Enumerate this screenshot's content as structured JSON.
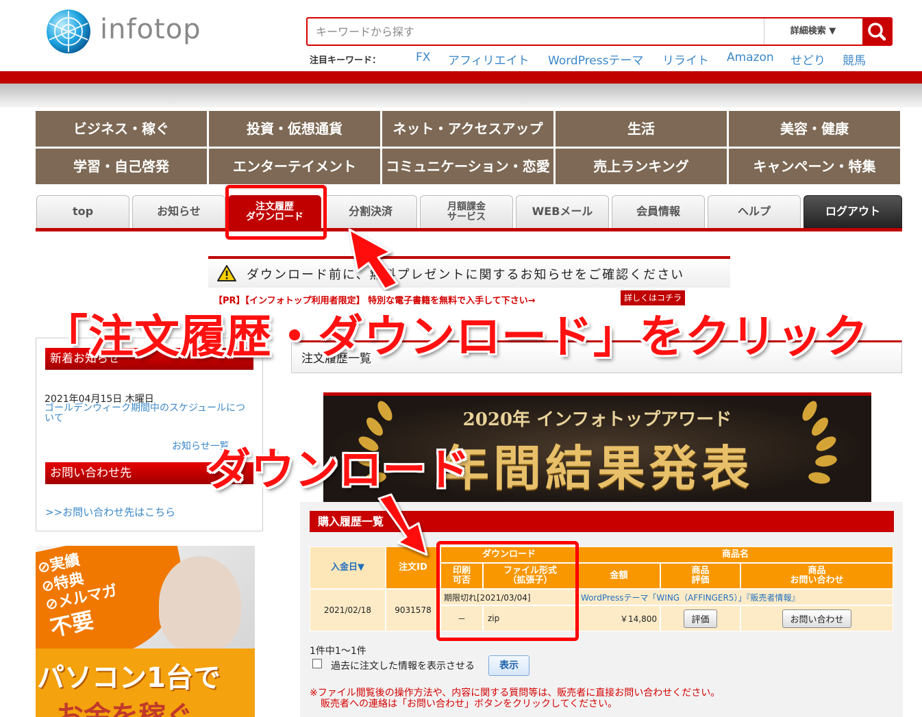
{
  "header": {
    "logo_text": "infotop",
    "search_placeholder": "キーワードから探す",
    "detail_search": "詳細検索 ▼",
    "keywords_label": "注目キーワード：",
    "keywords": [
      "FX",
      "アフィリエイト",
      "WordPressテーマ",
      "リライト",
      "Amazon",
      "せどり",
      "競馬"
    ]
  },
  "categories": [
    "ビジネス・稼ぐ",
    "投資・仮想通貨",
    "ネット・アクセスアップ",
    "生活",
    "美容・健康",
    "学習・自己啓発",
    "エンターテイメント",
    "コミュニケーション・恋愛",
    "売上ランキング",
    "キャンペーン・特集"
  ],
  "tabs": [
    {
      "label": "top"
    },
    {
      "label": "お知らせ"
    },
    {
      "label": "注文履歴\nダウンロード"
    },
    {
      "label": "分割決済"
    },
    {
      "label": "月額課金\nサービス"
    },
    {
      "label": "WEBメール"
    },
    {
      "label": "会員情報"
    },
    {
      "label": "ヘルプ"
    },
    {
      "label": "ログアウト"
    }
  ],
  "notice": {
    "text": "ダウンロード前に、無料プレゼントに関するお知らせをご確認ください",
    "pr_text": "【PR】【インフォトップ利用者限定】 特別な電子書籍を無料で入手して下さい→",
    "pr_button": "詳しくはコチラ"
  },
  "annotations": {
    "main": "「注文履歴・ダウンロード」をクリック",
    "download": "ダウンロード"
  },
  "sidebar": {
    "news_heading": "新着お知らせ",
    "news_date": "2021年04月15日 木曜日",
    "news_link": "ゴールデンウィーク期間中のスケジュールについて",
    "news_more": "お知らせ一覧",
    "contact_heading": "お問い合わせ先",
    "contact_link": ">>お問い合わせ先はこちら",
    "promo_badges": [
      "実績",
      "特典",
      "メルマガ"
    ],
    "promo_unneeded": "不要",
    "promo_text": "パソコン1台で",
    "promo_text2": "お金を稼ぐ"
  },
  "main": {
    "page_title": "注文履歴一覧",
    "banner_sub": "2020年 インフォトップアワード",
    "banner_main": "年間結果発表",
    "purchase_heading": "購入履歴一覧",
    "table": {
      "headers": {
        "date": "入金日▼",
        "order_id": "注文ID",
        "download": "ダウンロード",
        "print": "印刷\n可否",
        "file_format": "ファイル形式\n（拡張子）",
        "product_name": "商品名",
        "amount": "金額",
        "review": "商品\n評価",
        "inquiry": "商品\nお問い合わせ"
      },
      "row": {
        "date": "2021/02/18",
        "order_id": "9031578",
        "expired": "期限切れ[2021/03/04]",
        "product": "WordPressテーマ「WING（AFFINGER5）」『販売者情報』",
        "print": "－",
        "format": "zip",
        "amount": "￥14,800",
        "review_btn": "評価",
        "inquiry_btn": "お問い合わせ"
      }
    },
    "count_text": "1件中1〜1件",
    "past_checkbox_label": "過去に注文した情報を表示させる",
    "show_button": "表示",
    "note_line1": "※ファイル閲覧後の操作方法や、内容に関する質問等は、販売者に直接お問い合わせください。",
    "note_line2": "販売者への連絡は「お問い合わせ」ボタンをクリックしてください。"
  },
  "colors": {
    "brand_red": "#c00000",
    "category_brown": "#7d6955",
    "table_orange": "#f99700",
    "link_blue": "#3a87c8",
    "annotation_red": "#ff1111"
  }
}
